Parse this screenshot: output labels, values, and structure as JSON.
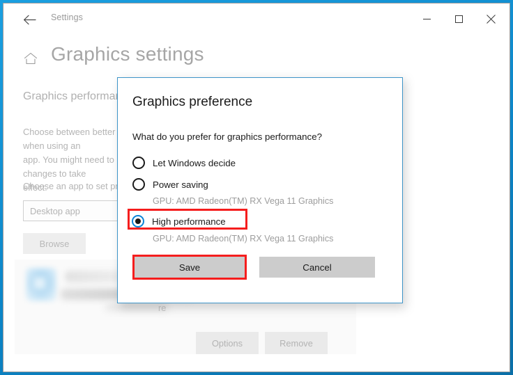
{
  "window": {
    "back_icon": "back-arrow-icon",
    "title": "Settings",
    "minimize_glyph": "─",
    "maximize_glyph": "□",
    "close_glyph": "✕",
    "frame_color": "#0d86c8"
  },
  "page": {
    "home_icon": "home-icon",
    "title": "Graphics settings",
    "section_heading": "Graphics performance preference",
    "body_text": "Choose between better performance or battery life when using an\napp. You might need to restart the app for your changes to take\neffect.",
    "choose_label": "Choose an app to set preference",
    "app_type_value": "Desktop app",
    "browse_label": "Browse",
    "ghost_s": "s",
    "ghost_re": "re",
    "options_label": "Options",
    "remove_label": "Remove"
  },
  "dialog": {
    "title": "Graphics preference",
    "question": "What do you prefer for graphics performance?",
    "options": [
      {
        "label": "Let Windows decide",
        "checked": false,
        "gpu": ""
      },
      {
        "label": "Power saving",
        "checked": false,
        "gpu": "GPU: AMD Radeon(TM) RX Vega 11 Graphics"
      },
      {
        "label": "High performance",
        "checked": true,
        "gpu": "GPU: AMD Radeon(TM) RX Vega 11 Graphics"
      }
    ],
    "save_label": "Save",
    "cancel_label": "Cancel",
    "border_color": "#3d94c8",
    "highlight_color": "#f51d1d",
    "accent_color": "#0a84d8"
  }
}
